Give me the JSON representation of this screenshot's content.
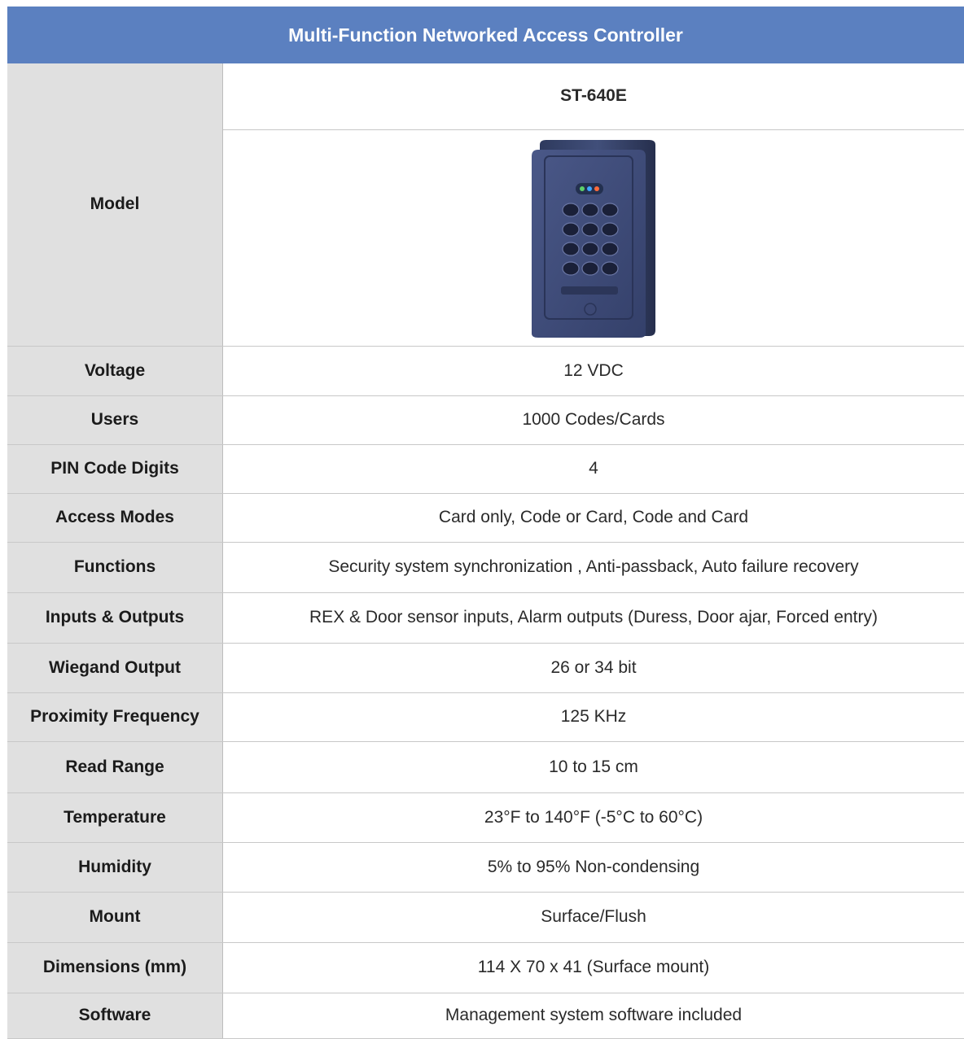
{
  "header": {
    "title": "Multi-Function Networked Access Controller"
  },
  "model": {
    "label": "Model",
    "name": "ST-640E",
    "image_icon": "keypad-access-controller-icon"
  },
  "specs": [
    {
      "label": "Voltage",
      "value": "12 VDC"
    },
    {
      "label": "Users",
      "value": "1000 Codes/Cards"
    },
    {
      "label": "PIN Code Digits",
      "value": "4"
    },
    {
      "label": "Access Modes",
      "value": "Card only, Code or Card, Code and Card"
    },
    {
      "label": "Functions",
      "value": "Security system synchronization , Anti-passback, Auto failure recovery"
    },
    {
      "label": "Inputs & Outputs",
      "value": "REX & Door sensor inputs, Alarm outputs (Duress, Door ajar, Forced entry)"
    },
    {
      "label": "Wiegand Output",
      "value": "26 or 34 bit"
    },
    {
      "label": "Proximity Frequency",
      "value": "125 KHz"
    },
    {
      "label": "Read Range",
      "value": "10 to 15 cm"
    },
    {
      "label": "Temperature",
      "value": "23°F to 140°F (-5°C to 60°C)"
    },
    {
      "label": "Humidity",
      "value": "5% to 95% Non-condensing"
    },
    {
      "label": "Mount",
      "value": "Surface/Flush"
    },
    {
      "label": "Dimensions (mm)",
      "value": "114 X 70 x 41 (Surface mount)"
    },
    {
      "label": "Software",
      "value": "Management system software included"
    }
  ],
  "colors": {
    "header_bg": "#5b80c0",
    "label_bg": "#e0e0e0",
    "divider": "#c8c8c8"
  }
}
